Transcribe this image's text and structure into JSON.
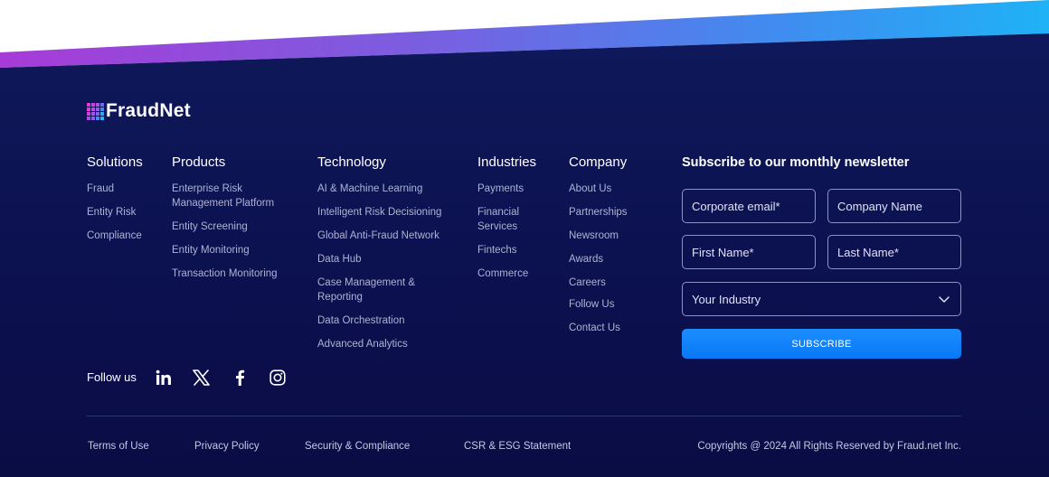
{
  "brand": {
    "name": "FraudNet",
    "grid_colors": [
      "#e63ad0",
      "#d23ee0",
      "#a552ee",
      "#6f6af5",
      "#e63ad0",
      "#c046e4",
      "#8c5cf2",
      "#4d86f7",
      "#d23ee0",
      "#a552ee",
      "#6f6af5",
      "#2fa6f8",
      "#b64ae6",
      "#8c5cf2",
      "#4d86f7",
      "#21b7f8"
    ]
  },
  "columns": [
    {
      "title": "Solutions",
      "items": [
        "Fraud",
        "Entity Risk",
        "Compliance"
      ]
    },
    {
      "title": "Products",
      "items": [
        "Enterprise Risk Management Platform",
        "Entity Screening",
        "Entity Monitoring",
        "Transaction Monitoring"
      ]
    },
    {
      "title": "Technology",
      "items": [
        "AI & Machine Learning",
        "Intelligent Risk Decisioning",
        "Global Anti-Fraud Network",
        "Data Hub",
        "Case Management & Reporting",
        "Data Orchestration",
        "Advanced Analytics"
      ]
    },
    {
      "title": "Industries",
      "items": [
        "Payments",
        "Financial Services",
        "Fintechs",
        "Commerce"
      ]
    },
    {
      "title": "Company",
      "items": [
        "About Us",
        "Partnerships",
        "Newsroom",
        "Awards",
        "Careers",
        "Follow Us",
        "Contact Us"
      ]
    }
  ],
  "newsletter": {
    "title": "Subscribe to our monthly newsletter",
    "email_placeholder": "Corporate email*",
    "company_placeholder": "Company Name",
    "first_name_placeholder": "First Name*",
    "last_name_placeholder": "Last Name*",
    "industry_value": "Your Industry",
    "subscribe_label": "SUBSCRIBE"
  },
  "follow": {
    "label": "Follow us",
    "icons": [
      "linkedin-icon",
      "x-icon",
      "facebook-icon",
      "instagram-icon"
    ]
  },
  "legal_links": [
    "Terms of Use",
    "Privacy Policy",
    "Security & Compliance",
    "CSR & ESG Statement"
  ],
  "copyright": "Copyrights @ 2024 All Rights Reserved by Fraud.net Inc.",
  "colors": {
    "background": "#0c1150",
    "accent": "#0a78f6",
    "swoosh_start": "#a73bd8",
    "swoosh_end": "#1fb2f6"
  }
}
